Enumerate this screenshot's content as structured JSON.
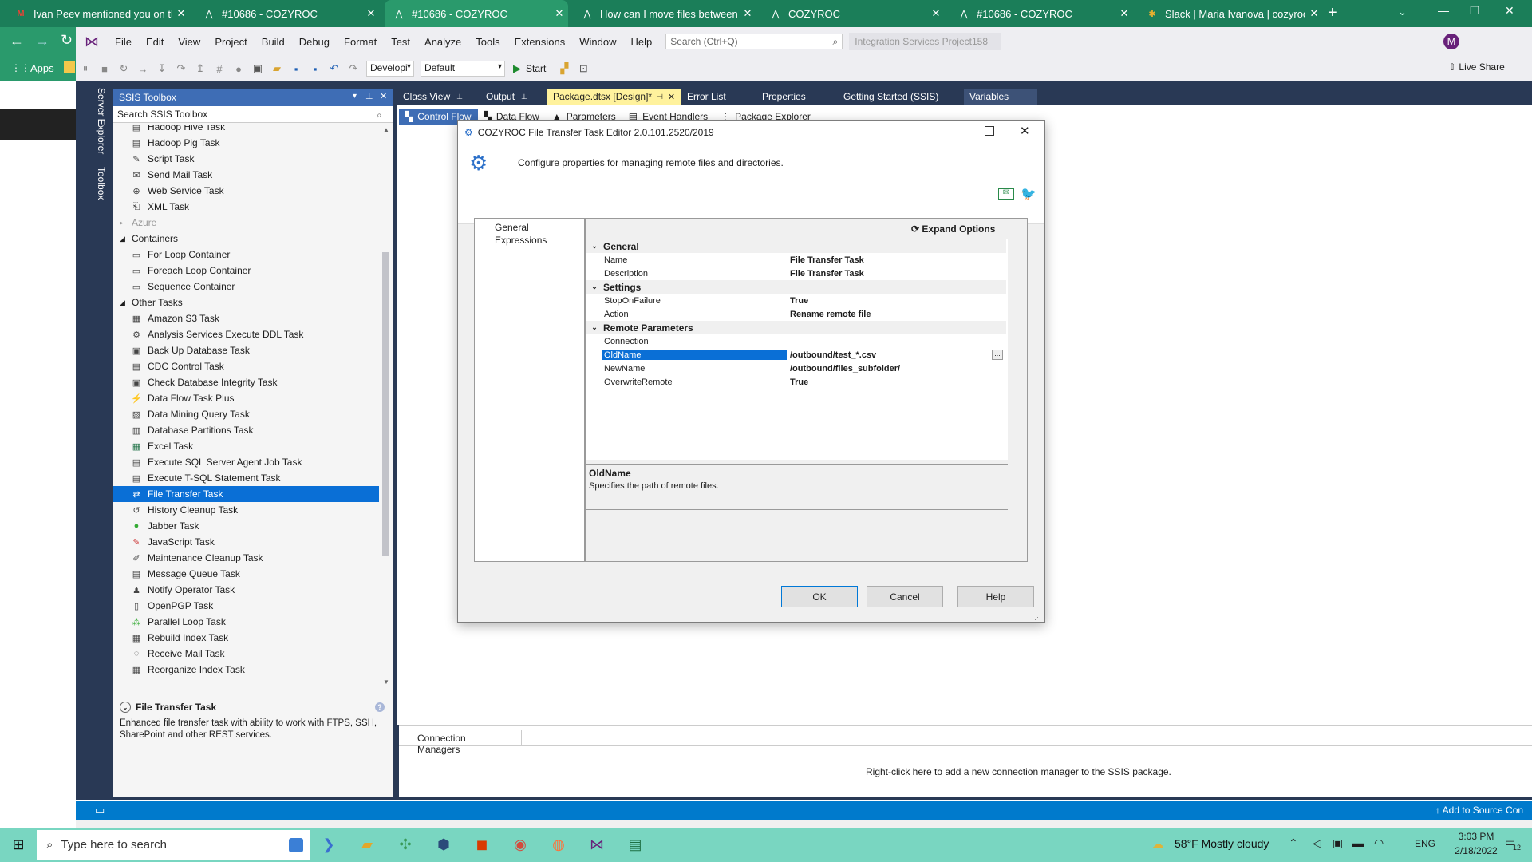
{
  "browser": {
    "tabs": [
      {
        "title": "Ivan Peev mentioned you on the",
        "icon": "gmail-icon"
      },
      {
        "title": "#10686 - COZYROC",
        "icon": "cozyroc-icon"
      },
      {
        "title": "#10686 - COZYROC",
        "icon": "cozyroc-icon",
        "active": true
      },
      {
        "title": "How can I move files between fo",
        "icon": "cozyroc-icon"
      },
      {
        "title": "COZYROC",
        "icon": "cozyroc-icon"
      },
      {
        "title": "#10686 - COZYROC",
        "icon": "cozyroc-icon"
      },
      {
        "title": "Slack | Maria Ivanova | cozyroc",
        "icon": "slack-icon"
      }
    ],
    "new_tab": "+",
    "bookmarks_apps": "Apps",
    "bookmarks_extra": "2"
  },
  "vs": {
    "menu": [
      "File",
      "Edit",
      "View",
      "Project",
      "Build",
      "Debug",
      "Format",
      "Test",
      "Analyze",
      "Tools",
      "Extensions",
      "Window",
      "Help"
    ],
    "search_placeholder": "Search (Ctrl+Q)",
    "project_title": "Integration Services Project158",
    "avatar_letter": "M",
    "live_share": "Live Share",
    "config_combo": "Developi",
    "platform_combo": "Default",
    "start_label": "Start",
    "side_tabs": [
      "Server Explorer",
      "Toolbox"
    ],
    "doc_tabs": [
      "Class View",
      "Output",
      "Package.dtsx [Design]*",
      "Error List",
      "Properties",
      "Getting Started (SSIS)",
      "Variables"
    ],
    "design_tabs": [
      "Control Flow",
      "Data Flow",
      "Parameters",
      "Event Handlers",
      "Package Explorer"
    ],
    "conn_tab": "Connection Managers",
    "conn_hint": "Right-click here to add a new connection manager to the SSIS package.",
    "status_right": "Add to Source Con"
  },
  "toolbox": {
    "title": "SSIS Toolbox",
    "search_placeholder": "Search SSIS Toolbox",
    "items_top": [
      "Hadoop Hive Task",
      "Hadoop Pig Task",
      "Script Task",
      "Send Mail Task",
      "Web Service Task",
      "XML Task"
    ],
    "group_azure": "Azure",
    "group_containers": "Containers",
    "containers": [
      "For Loop Container",
      "Foreach Loop Container",
      "Sequence Container"
    ],
    "group_other": "Other Tasks",
    "other_tasks": [
      "Amazon S3 Task",
      "Analysis Services Execute DDL Task",
      "Back Up Database Task",
      "CDC Control Task",
      "Check Database Integrity Task",
      "Data Flow Task Plus",
      "Data Mining Query Task",
      "Database Partitions Task",
      "Excel Task",
      "Execute SQL Server Agent Job Task",
      "Execute T-SQL Statement Task",
      "File Transfer Task",
      "History Cleanup Task",
      "Jabber Task",
      "JavaScript Task",
      "Maintenance Cleanup Task",
      "Message Queue Task",
      "Notify Operator Task",
      "OpenPGP Task",
      "Parallel Loop Task",
      "Rebuild Index Task",
      "Receive Mail Task",
      "Reorganize Index Task"
    ],
    "selected": "File Transfer Task",
    "desc_title": "File Transfer Task",
    "desc_text": "Enhanced file transfer task with ability to work with FTPS, SSH, SharePoint and other REST services."
  },
  "dialog": {
    "title": "COZYROC File Transfer Task Editor 2.0.101.2520/2019",
    "subtitle": "Configure properties for managing remote files and directories.",
    "nav": [
      "General",
      "Expressions"
    ],
    "expand_options": "Expand Options",
    "sections": {
      "general": "General",
      "settings": "Settings",
      "remote": "Remote Parameters"
    },
    "props": {
      "name_k": "Name",
      "name_v": "File Transfer Task",
      "desc_k": "Description",
      "desc_v": "File Transfer Task",
      "stop_k": "StopOnFailure",
      "stop_v": "True",
      "action_k": "Action",
      "action_v": "Rename remote file",
      "conn_k": "Connection",
      "conn_v": "",
      "old_k": "OldName",
      "old_v": "/outbound/test_*.csv",
      "new_k": "NewName",
      "new_v": "/outbound/files_subfolder/",
      "over_k": "OverwriteRemote",
      "over_v": "True"
    },
    "ellipsis": "...",
    "help_title": "OldName",
    "help_text": "Specifies the path of remote files.",
    "ok": "OK",
    "cancel": "Cancel",
    "help": "Help"
  },
  "taskbar": {
    "search_placeholder": "Type here to search",
    "weather": "58°F  Mostly cloudy",
    "lang": "ENG",
    "time": "3:03 PM",
    "date": "2/18/2022",
    "notif_count": "12"
  },
  "colors": {
    "chrome_green": "#1b7e59",
    "vs_dark": "#293955",
    "selection": "#0a6fd6",
    "accent": "#3e6db5",
    "taskbar": "#79d6c1"
  }
}
